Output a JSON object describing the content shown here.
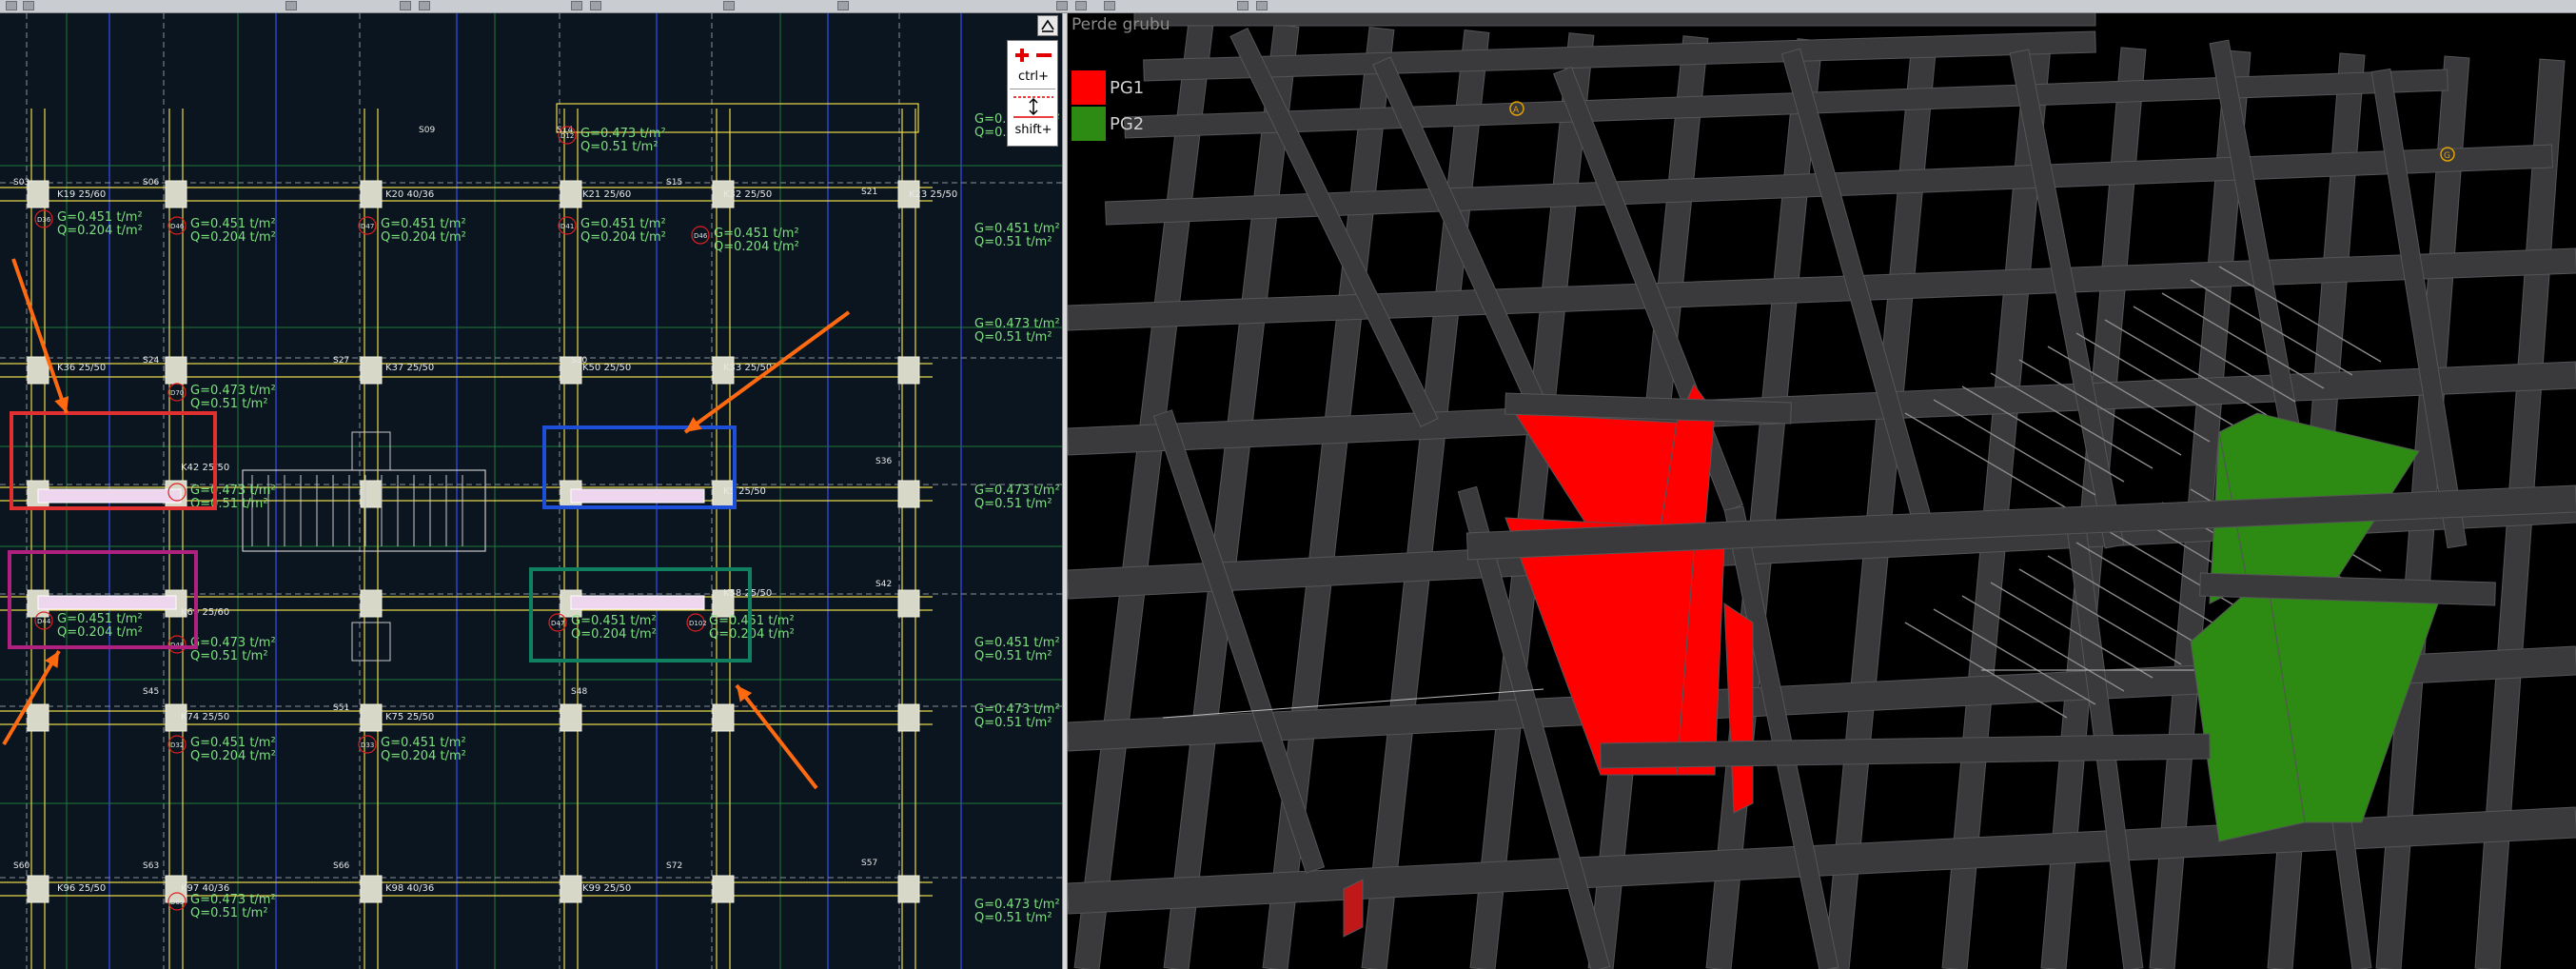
{
  "plan_view": {
    "beam_labels": [
      "K19 25/60",
      "K20 40/36",
      "K21 25/60",
      "K32 25/50",
      "K36 25/50",
      "K37 25/50",
      "K42 25/50",
      "K5 25/50",
      "K69 25/60",
      "K58 25/50",
      "K74 25/50",
      "K75 25/50",
      "K96 25/50",
      "K97 40/36",
      "K98 40/36",
      "K99 25/50",
      "K50 25/50",
      "K33 25/50",
      "K23 25/50"
    ],
    "column_labels": [
      "S03",
      "S06",
      "S15",
      "S21",
      "S24",
      "S27",
      "S30",
      "S36",
      "S42",
      "S45",
      "S48",
      "S51",
      "S57",
      "S60",
      "S63",
      "S66",
      "S72",
      "S14",
      "S09"
    ],
    "slab_loads": [
      {
        "id": "D36",
        "g": "G=0.451 t/m²",
        "q": "Q=0.204 t/m²"
      },
      {
        "id": "D46",
        "g": "G=0.451 t/m²",
        "q": "Q=0.204 t/m²"
      },
      {
        "id": "D47",
        "g": "G=0.451 t/m²",
        "q": "Q=0.204 t/m²"
      },
      {
        "id": "D41",
        "g": "G=0.451 t/m²",
        "q": "Q=0.204 t/m²"
      },
      {
        "id": "D46",
        "g": "G=0.451 t/m²",
        "q": "Q=0.204 t/m²"
      },
      {
        "id": "D12",
        "g": "G=0.473 t/m²",
        "q": "Q=0.51 t/m²"
      },
      {
        "id": "D70",
        "g": "G=0.473 t/m²",
        "q": "Q=0.51 t/m²"
      },
      {
        "id": "D71",
        "g": "G=0.473 t/m²",
        "q": "Q=0.51 t/m²"
      },
      {
        "id": "D44",
        "g": "G=0.451 t/m²",
        "q": "Q=0.204 t/m²"
      },
      {
        "id": "D48",
        "g": "G=0.473 t/m²",
        "q": "Q=0.51 t/m²"
      },
      {
        "id": "D47",
        "g": "G=0.451 t/m²",
        "q": "Q=0.204 t/m²"
      },
      {
        "id": "D102",
        "g": "G=0.451 t/m²",
        "q": "Q=0.204 t/m²"
      },
      {
        "id": "D32",
        "g": "G=0.451 t/m²",
        "q": "Q=0.204 t/m²"
      },
      {
        "id": "D33",
        "g": "G=0.451 t/m²",
        "q": "Q=0.204 t/m²"
      },
      {
        "id": "D65",
        "g": "G=0.473 t/m²",
        "q": "Q=0.51 t/m²"
      }
    ],
    "right_edge_loads": [
      {
        "g": "G=0.473 t/m²",
        "q": "Q=0.51 t/m²"
      },
      {
        "g": "G=0.451 t/m²",
        "q": "Q=0.51 t/m²"
      },
      {
        "g": "G=0.473 t/m²",
        "q": "Q=0.51 t/m²"
      },
      {
        "g": "G=0.473 t/m²",
        "q": "Q=0.51 t/m²"
      },
      {
        "g": "G=0.451 t/m²",
        "q": "Q=0.51 t/m²"
      },
      {
        "g": "G=0.473 t/m²",
        "q": "Q=0.51 t/m²"
      },
      {
        "g": "G=0.473 t/m²",
        "q": "Q=0.51 t/m²"
      }
    ],
    "highlight_colors": {
      "red": "#e03030",
      "blue": "#1d4fd8",
      "magenta": "#b0207f",
      "teal": "#0f8060",
      "arrow": "#ff6a10"
    }
  },
  "zoom_panel": {
    "plus_minus": "+ −",
    "ctrl_label": "ctrl+",
    "shift_label": "shift+"
  },
  "legend": {
    "title": "Perde grubu",
    "items": [
      {
        "name": "PG1",
        "color": "#ff0000"
      },
      {
        "name": "PG2",
        "color": "#2d8a12"
      }
    ]
  },
  "view3d": {
    "markers": [
      "A",
      "G"
    ]
  }
}
